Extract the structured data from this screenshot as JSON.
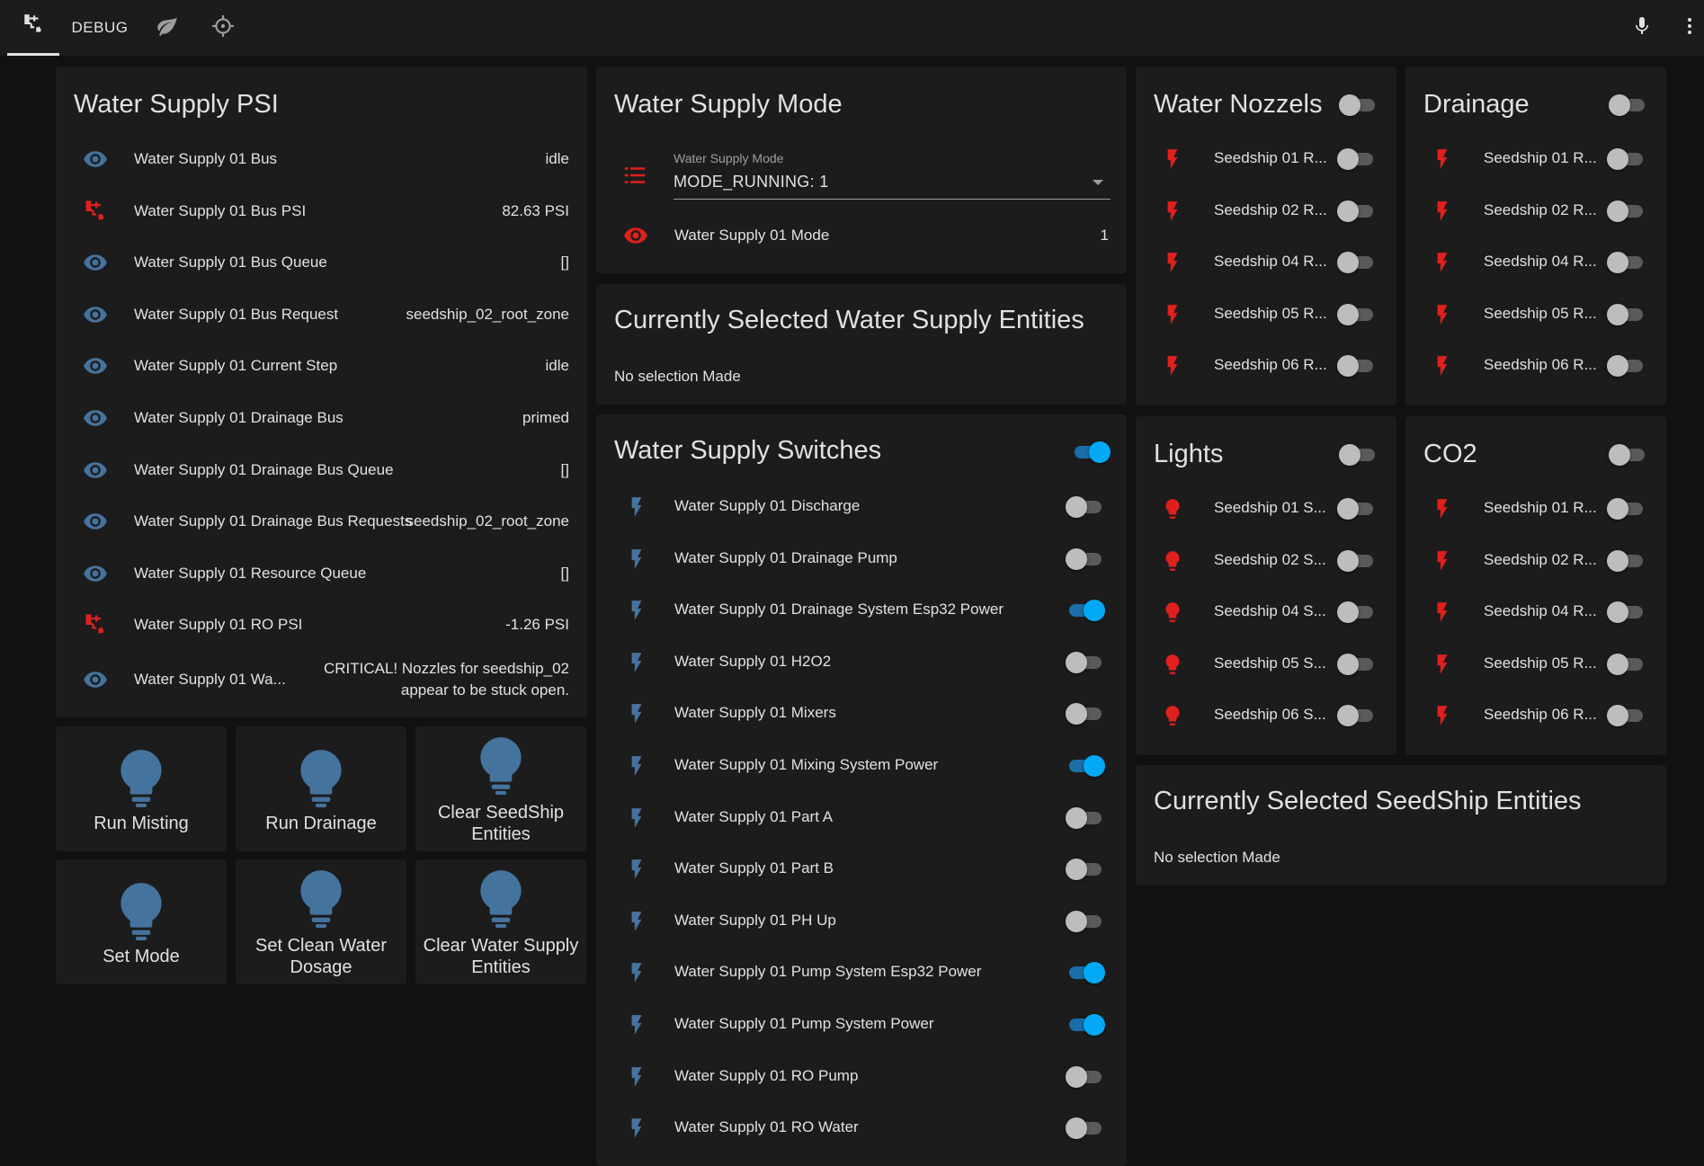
{
  "topbar": {
    "tabs": [
      {
        "name": "tab-home",
        "icon": "faucet-icon"
      },
      {
        "name": "tab-debug",
        "label": "DEBUG"
      },
      {
        "name": "tab-leaf",
        "icon": "leaf-icon"
      },
      {
        "name": "tab-target",
        "icon": "crosshairs-icon"
      }
    ],
    "right_icons": [
      "microphone-icon",
      "more-vert-icon"
    ]
  },
  "colors": {
    "accent_blue": "#03a9f4",
    "icon_blue": "#44739e",
    "icon_red": "#e0201d",
    "card_bg": "#1c1c1c",
    "page_bg": "#111111"
  },
  "psi_card": {
    "title": "Water Supply PSI",
    "rows": [
      {
        "icon": "eye",
        "label": "Water Supply 01 Bus",
        "value": "idle"
      },
      {
        "icon": "faucet",
        "label": "Water Supply 01 Bus PSI",
        "value": "82.63 PSI"
      },
      {
        "icon": "eye",
        "label": "Water Supply 01 Bus Queue",
        "value": "[]"
      },
      {
        "icon": "eye",
        "label": "Water Supply 01 Bus Request",
        "value": "seedship_02_root_zone"
      },
      {
        "icon": "eye",
        "label": "Water Supply 01 Current Step",
        "value": "idle"
      },
      {
        "icon": "eye",
        "label": "Water Supply 01 Drainage Bus",
        "value": "primed"
      },
      {
        "icon": "eye",
        "label": "Water Supply 01 Drainage Bus Queue",
        "value": "[]"
      },
      {
        "icon": "eye",
        "label": "Water Supply 01 Drainage Bus Requests",
        "value": "seedship_02_root_zone"
      },
      {
        "icon": "eye",
        "label": "Water Supply 01 Resource Queue",
        "value": "[]"
      },
      {
        "icon": "faucet",
        "label": "Water Supply 01 RO PSI",
        "value": "-1.26 PSI"
      },
      {
        "icon": "eye",
        "label": "Water Supply 01 Wa...",
        "value": "CRITICAL! Nozzles for seedship_02 appear to be stuck open."
      }
    ]
  },
  "buttons": [
    {
      "label": "Run Misting"
    },
    {
      "label": "Run Drainage"
    },
    {
      "label": "Clear SeedShip Entities"
    },
    {
      "label": "Set Mode"
    },
    {
      "label": "Set Clean Water Dosage"
    },
    {
      "label": "Clear Water Supply Entities"
    }
  ],
  "mode_card": {
    "title": "Water Supply Mode",
    "select_caption": "Water Supply Mode",
    "select_value": "MODE_RUNNING: 1",
    "row_label": "Water Supply 01 Mode",
    "row_value": "1"
  },
  "selected_ws_card": {
    "title": "Currently Selected Water Supply Entities",
    "text": "No selection Made"
  },
  "switches_card": {
    "title": "Water Supply Switches",
    "master_on": true,
    "rows": [
      {
        "label": "Water Supply 01 Discharge",
        "on": false
      },
      {
        "label": "Water Supply 01 Drainage Pump",
        "on": false
      },
      {
        "label": "Water Supply 01 Drainage System Esp32 Power",
        "on": true
      },
      {
        "label": "Water Supply 01 H2O2",
        "on": false
      },
      {
        "label": "Water Supply 01 Mixers",
        "on": false
      },
      {
        "label": "Water Supply 01 Mixing System Power",
        "on": true
      },
      {
        "label": "Water Supply 01 Part A",
        "on": false
      },
      {
        "label": "Water Supply 01 Part B",
        "on": false
      },
      {
        "label": "Water Supply 01 PH Up",
        "on": false
      },
      {
        "label": "Water Supply 01 Pump System Esp32 Power",
        "on": true
      },
      {
        "label": "Water Supply 01 Pump System Power",
        "on": true
      },
      {
        "label": "Water Supply 01 RO Pump",
        "on": false
      },
      {
        "label": "Water Supply 01 RO Water",
        "on": false
      }
    ]
  },
  "nozzles_card": {
    "title": "Water Nozzels",
    "rows": [
      "Seedship 01 R...",
      "Seedship 02 R...",
      "Seedship 04 R...",
      "Seedship 05 R...",
      "Seedship 06 R..."
    ]
  },
  "drainage_card": {
    "title": "Drainage",
    "rows": [
      "Seedship 01 R...",
      "Seedship 02 R...",
      "Seedship 04 R...",
      "Seedship 05 R...",
      "Seedship 06 R..."
    ]
  },
  "lights_card": {
    "title": "Lights",
    "rows": [
      "Seedship 01 S...",
      "Seedship 02 S...",
      "Seedship 04 S...",
      "Seedship 05 S...",
      "Seedship 06 S..."
    ]
  },
  "co2_card": {
    "title": "CO2",
    "rows": [
      "Seedship 01 R...",
      "Seedship 02 R...",
      "Seedship 04 R...",
      "Seedship 05 R...",
      "Seedship 06 R..."
    ]
  },
  "selected_seedship_card": {
    "title": "Currently Selected SeedShip Entities",
    "text": "No selection Made"
  }
}
